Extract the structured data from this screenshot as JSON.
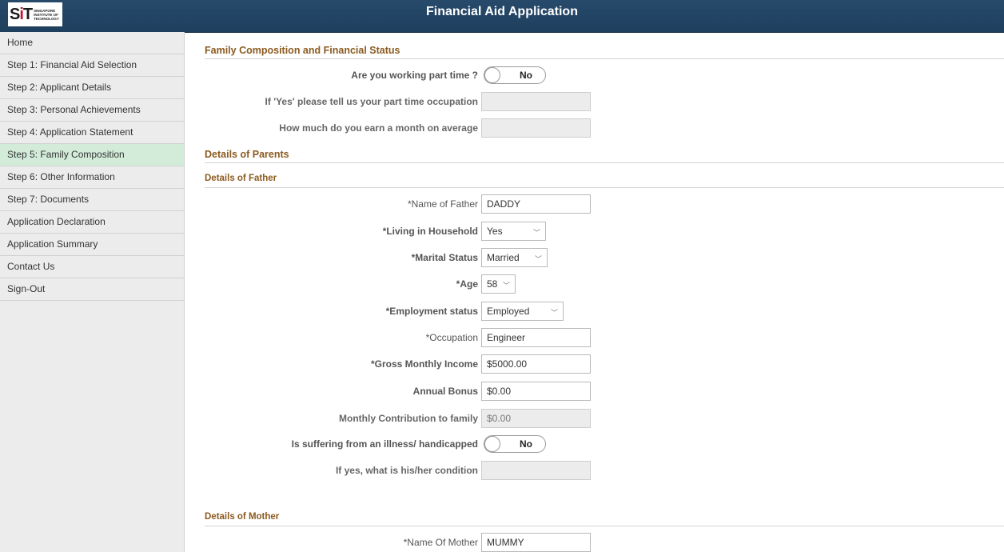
{
  "header": {
    "title": "Financial Aid Application",
    "logo_mark": "SIT",
    "logo_text": [
      "SINGAPORE",
      "INSTITUTE OF",
      "TECHNOLOGY"
    ]
  },
  "sidebar": {
    "items": [
      {
        "label": "Home",
        "active": false
      },
      {
        "label": "Step 1: Financial Aid Selection",
        "active": false
      },
      {
        "label": "Step 2: Applicant Details",
        "active": false
      },
      {
        "label": "Step 3: Personal Achievements",
        "active": false
      },
      {
        "label": "Step 4: Application Statement",
        "active": false
      },
      {
        "label": "Step 5: Family Composition",
        "active": true
      },
      {
        "label": "Step 6: Other Information",
        "active": false
      },
      {
        "label": "Step 7: Documents",
        "active": false
      },
      {
        "label": "Application Declaration",
        "active": false
      },
      {
        "label": "Application Summary",
        "active": false
      },
      {
        "label": "Contact Us",
        "active": false
      },
      {
        "label": "Sign-Out",
        "active": false
      }
    ]
  },
  "family": {
    "heading": "Family Composition and Financial Status",
    "part_time_label": "Are you working part time ?",
    "part_time_value": "No",
    "occupation_label": "If 'Yes' please tell us your part time occupation",
    "occupation_value": "",
    "earn_label": "How much do you earn a month on average",
    "earn_value": ""
  },
  "parents": {
    "heading": "Details of Parents"
  },
  "father": {
    "heading": "Details of Father",
    "name_label": "*Name of Father",
    "name_value": "DADDY",
    "household_label": "*Living in Household",
    "household_value": "Yes",
    "marital_label": "*Marital Status",
    "marital_value": "Married",
    "age_label": "*Age",
    "age_value": "58",
    "employment_label": "*Employment status",
    "employment_value": "Employed",
    "occupation_label": "*Occupation",
    "occupation_value": "Engineer",
    "income_label": "*Gross Monthly Income",
    "income_value": "$5000.00",
    "bonus_label": "Annual Bonus",
    "bonus_value": "$0.00",
    "contribution_label": "Monthly Contribution to family",
    "contribution_value": "$0.00",
    "illness_label": "Is suffering from an illness/ handicapped",
    "illness_value": "No",
    "condition_label": "If yes, what is his/her condition",
    "condition_value": ""
  },
  "mother": {
    "heading": "Details of Mother",
    "name_label": "*Name Of Mother",
    "name_value": "MUMMY"
  },
  "icons": {
    "chevron": "chevron-down-icon"
  }
}
